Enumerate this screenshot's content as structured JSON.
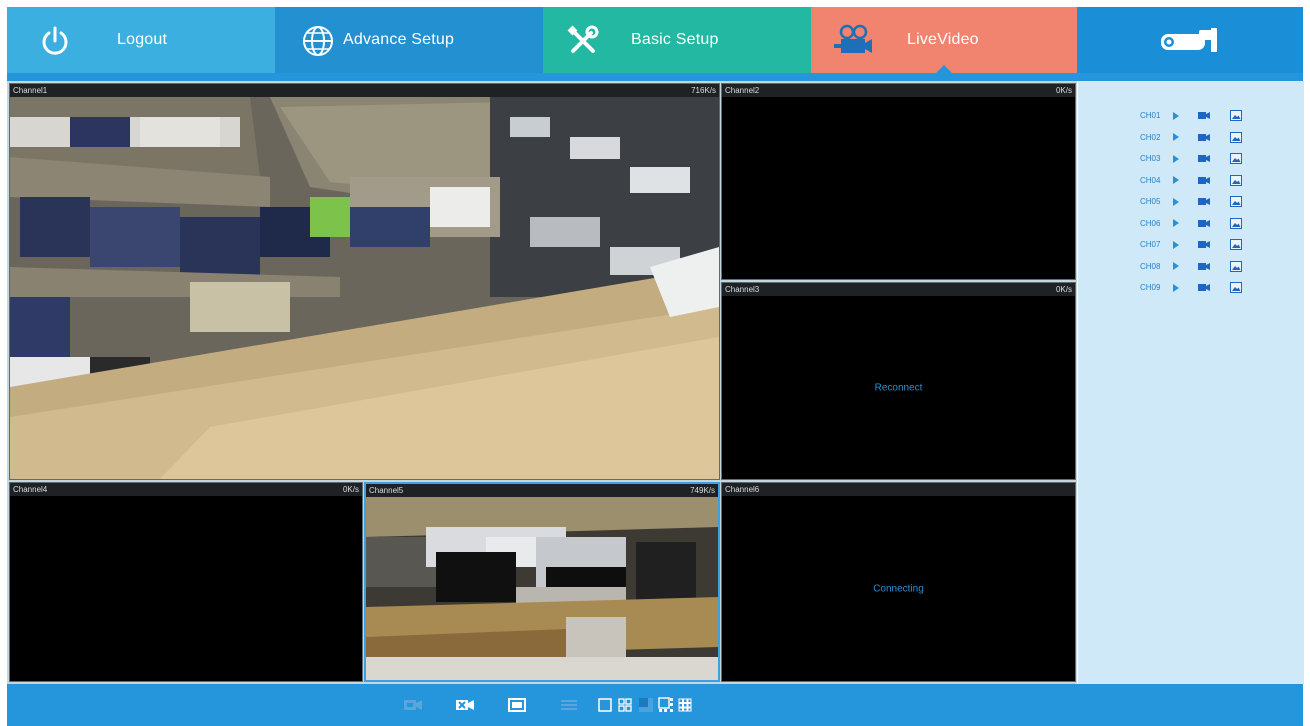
{
  "nav": {
    "logout_label": "Logout",
    "advance_label": "Advance Setup",
    "basic_label": "Basic Setup",
    "live_label": "LiveVideo",
    "active_tab": "LiveVideo"
  },
  "channels": [
    {
      "name": "Channel1",
      "rate": "716K/s",
      "status": ""
    },
    {
      "name": "Channel2",
      "rate": "0K/s",
      "status": ""
    },
    {
      "name": "Channel3",
      "rate": "0K/s",
      "status": "Reconnect"
    },
    {
      "name": "Channel4",
      "rate": "0K/s",
      "status": ""
    },
    {
      "name": "Channel5",
      "rate": "749K/s",
      "status": ""
    },
    {
      "name": "Channel6",
      "rate": "",
      "status": "Connecting"
    }
  ],
  "side_channels": [
    "CH01",
    "CH02",
    "CH03",
    "CH04",
    "CH05",
    "CH06",
    "CH07",
    "CH08",
    "CH09"
  ],
  "colors": {
    "logout": "#3bb0e0",
    "advance": "#2390d2",
    "basic": "#22b8a2",
    "live": "#f0846e",
    "brand": "#1a8fd8",
    "accent": "#2595dc",
    "side_panel": "#cfe9f8"
  },
  "icons": {
    "logout": "power-icon",
    "advance": "globe-icon",
    "basic": "tools-icon",
    "live": "movie-camera-icon",
    "brand": "bullet-camera-logo-icon"
  }
}
